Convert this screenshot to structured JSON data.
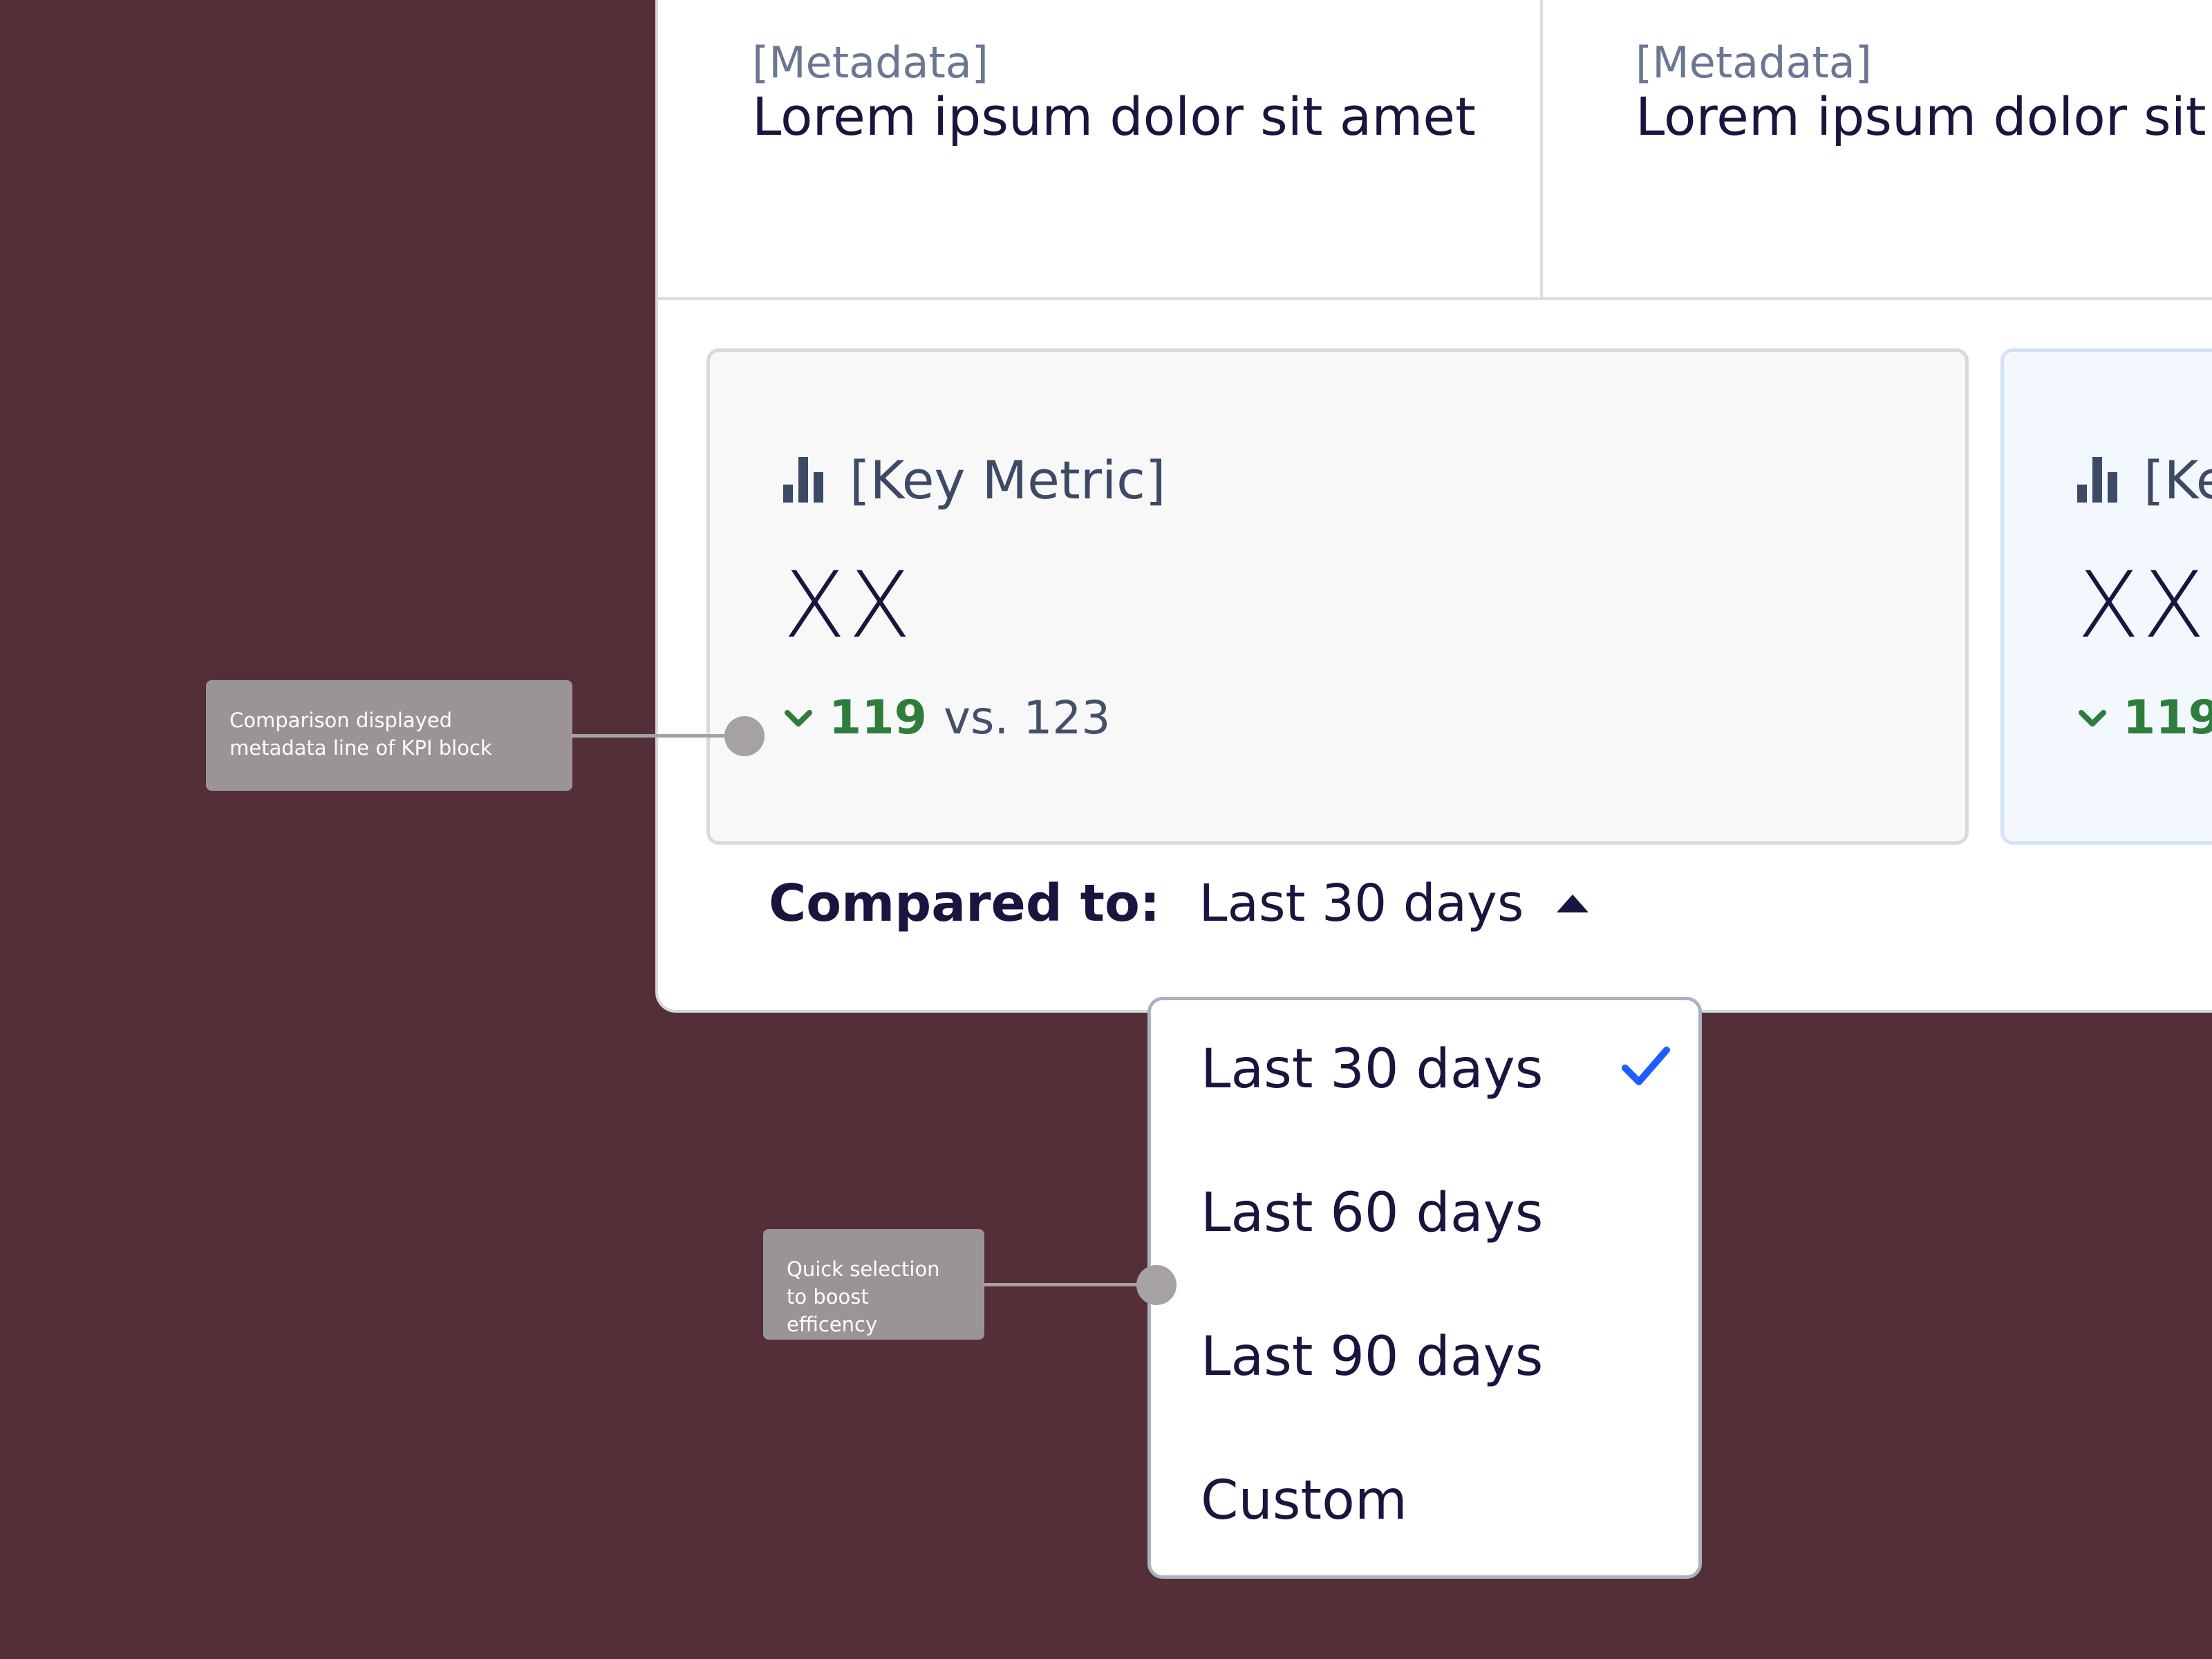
{
  "metadata_row": [
    {
      "label": "[Metadata]",
      "value": "Lorem ipsum dolor sit amet"
    },
    {
      "label": "[Metadata]",
      "value": "Lorem ipsum dolor sit a"
    }
  ],
  "kpis": [
    {
      "title": "[Key Metric]",
      "value": "XX",
      "delta": "119",
      "comparison": "vs. 123",
      "icon": "bar-chart-icon"
    },
    {
      "title": "[Ke",
      "value": "XX",
      "delta": "119",
      "icon": "bar-chart-icon"
    }
  ],
  "compared_to": {
    "label": "Compared to:",
    "value": "Last 30 days",
    "icon": "caret-up-icon"
  },
  "dropdown": {
    "options": [
      {
        "label": "Last 30 days",
        "selected": true
      },
      {
        "label": "Last 60 days",
        "selected": false
      },
      {
        "label": "Last 90 days",
        "selected": false
      },
      {
        "label": "Custom",
        "selected": false
      }
    ]
  },
  "annotations": [
    {
      "text": "Comparison displayed metadata line of KPI block"
    },
    {
      "text": "Quick selection to boost efficency"
    }
  ],
  "colors": {
    "background": "#542f38",
    "positive": "#2e7d3c",
    "check": "#1e5eff",
    "annotation": "#9a9498"
  }
}
